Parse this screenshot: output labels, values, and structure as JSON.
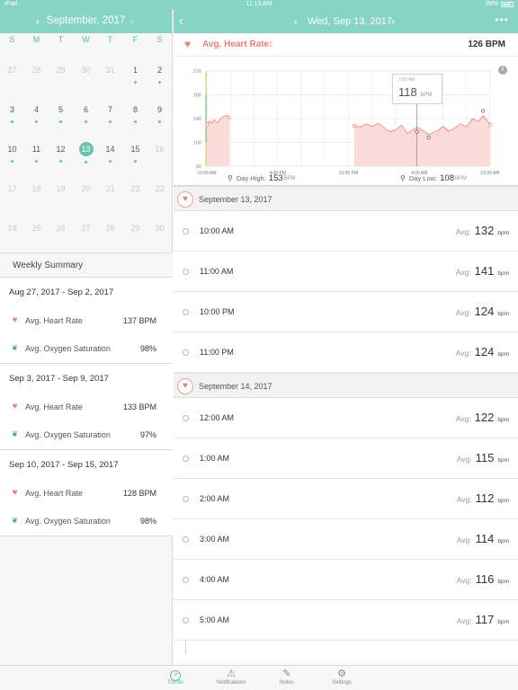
{
  "status_bar": {
    "left": "iPad",
    "time": "11:15 AM",
    "battery": "99%"
  },
  "calendar": {
    "month_title": "September, 2017",
    "prev_icon": "chevron-left-icon",
    "next_icon": "chevron-right-icon",
    "weekdays": [
      "S",
      "M",
      "T",
      "W",
      "T",
      "F",
      "S"
    ],
    "selected_day": "13",
    "weeks": [
      [
        {
          "d": "27",
          "dim": true
        },
        {
          "d": "28",
          "dim": true
        },
        {
          "d": "29",
          "dim": true
        },
        {
          "d": "30",
          "dim": true
        },
        {
          "d": "31",
          "dim": true
        },
        {
          "d": "1",
          "dot": true
        },
        {
          "d": "2",
          "dot": true
        }
      ],
      [
        {
          "d": "3",
          "dot": true
        },
        {
          "d": "4",
          "dot": true
        },
        {
          "d": "5",
          "dot": true
        },
        {
          "d": "6",
          "dot": true
        },
        {
          "d": "7",
          "dot": true
        },
        {
          "d": "8",
          "dot": true
        },
        {
          "d": "9",
          "dot": true
        }
      ],
      [
        {
          "d": "10",
          "dot": true
        },
        {
          "d": "11",
          "dot": true
        },
        {
          "d": "12",
          "dot": true
        },
        {
          "d": "13",
          "dot": true,
          "sel": true
        },
        {
          "d": "14",
          "dot": true
        },
        {
          "d": "15",
          "dot": true
        },
        {
          "d": "16",
          "dim": true
        }
      ],
      [
        {
          "d": "17",
          "dim": true
        },
        {
          "d": "18",
          "dim": true
        },
        {
          "d": "19",
          "dim": true
        },
        {
          "d": "20",
          "dim": true
        },
        {
          "d": "21",
          "dim": true
        },
        {
          "d": "22",
          "dim": true
        },
        {
          "d": "23",
          "dim": true
        }
      ],
      [
        {
          "d": "24",
          "dim": true
        },
        {
          "d": "25",
          "dim": true
        },
        {
          "d": "26",
          "dim": true
        },
        {
          "d": "27",
          "dim": true
        },
        {
          "d": "28",
          "dim": true
        },
        {
          "d": "29",
          "dim": true
        },
        {
          "d": "30",
          "dim": true
        }
      ]
    ]
  },
  "weekly_summary": {
    "title": "Weekly Summary",
    "weeks": [
      {
        "range": "Aug 27, 2017 - Sep 2, 2017",
        "hr_label": "Avg. Heart Rate",
        "hr_value": "137 BPM",
        "o2_label": "Avg. Oxygen Saturation",
        "o2_value": "98%"
      },
      {
        "range": "Sep 3, 2017 - Sep 9, 2017",
        "hr_label": "Avg. Heart Rate",
        "hr_value": "133 BPM",
        "o2_label": "Avg. Oxygen Saturation",
        "o2_value": "97%"
      },
      {
        "range": "Sep 10, 2017 - Sep 15, 2017",
        "hr_label": "Avg. Heart Rate",
        "hr_value": "128 BPM",
        "o2_label": "Avg. Oxygen Saturation",
        "o2_value": "98%"
      }
    ]
  },
  "detail": {
    "nav_title": "Wed, Sep 13, 2017",
    "more_icon": "more-icon",
    "heart_rate_label": "Avg. Heart Rate:",
    "heart_rate_value": "126 BPM",
    "tooltip_time": "3:50 AM",
    "tooltip_value": "118",
    "tooltip_unit": "BPM",
    "day_high_label": "Day High:",
    "day_high_value": "153",
    "day_low_label": "Day Low:",
    "day_low_value": "108",
    "bpm_unit": "BPM"
  },
  "chart_data": {
    "type": "area",
    "y_ticks": [
      60,
      100,
      140,
      180,
      220
    ],
    "ylim": [
      60,
      220
    ],
    "x_ticks": [
      "10:00 AM",
      "4:00 PM",
      "10:00 PM",
      "4:00 AM",
      "10:00 AM"
    ],
    "xlim_hours": [
      0,
      24
    ],
    "color": "#f08a80",
    "fill": "#fbdbd8",
    "segments": [
      [
        [
          0,
          130
        ],
        [
          0.2,
          136
        ],
        [
          0.4,
          132
        ],
        [
          0.6,
          138
        ],
        [
          0.9,
          133
        ],
        [
          1.2,
          141
        ],
        [
          1.5,
          144
        ],
        [
          1.7,
          146
        ],
        [
          1.9,
          142
        ]
      ],
      [
        [
          12.5,
          128
        ],
        [
          13,
          126
        ],
        [
          13.5,
          131
        ],
        [
          14,
          127
        ],
        [
          14.5,
          132
        ],
        [
          15,
          125
        ],
        [
          15.5,
          118
        ],
        [
          16,
          121
        ],
        [
          16.5,
          129
        ],
        [
          17,
          115
        ],
        [
          17.3,
          119
        ],
        [
          17.8,
          126
        ],
        [
          18.3,
          120
        ],
        [
          18.8,
          113
        ],
        [
          19.2,
          117
        ],
        [
          19.6,
          120
        ],
        [
          20,
          127
        ],
        [
          20.5,
          119
        ],
        [
          21,
          124
        ],
        [
          21.5,
          131
        ],
        [
          22,
          126
        ],
        [
          22.5,
          140
        ],
        [
          23,
          135
        ],
        [
          23.4,
          145
        ],
        [
          23.7,
          138
        ],
        [
          24,
          130
        ]
      ]
    ]
  },
  "readings": [
    {
      "date": "September 13, 2017",
      "entries": [
        {
          "time": "10:00 AM",
          "avg_label": "Avg:",
          "value": "132",
          "unit": "bpm"
        },
        {
          "time": "11:00 AM",
          "avg_label": "Avg:",
          "value": "141",
          "unit": "bpm"
        },
        {
          "time": "10:00 PM",
          "avg_label": "Avg:",
          "value": "124",
          "unit": "bpm"
        },
        {
          "time": "11:00 PM",
          "avg_label": "Avg:",
          "value": "124",
          "unit": "bpm"
        }
      ]
    },
    {
      "date": "September 14, 2017",
      "entries": [
        {
          "time": "12:00 AM",
          "avg_label": "Avg:",
          "value": "122",
          "unit": "bpm"
        },
        {
          "time": "1:00 AM",
          "avg_label": "Avg:",
          "value": "115",
          "unit": "bpm"
        },
        {
          "time": "2:00 AM",
          "avg_label": "Avg:",
          "value": "112",
          "unit": "bpm"
        },
        {
          "time": "3:00 AM",
          "avg_label": "Avg:",
          "value": "114",
          "unit": "bpm"
        },
        {
          "time": "4:00 AM",
          "avg_label": "Avg:",
          "value": "116",
          "unit": "bpm"
        },
        {
          "time": "5:00 AM",
          "avg_label": "Avg:",
          "value": "117",
          "unit": "bpm"
        }
      ]
    }
  ],
  "tabs": [
    {
      "label": "Trends",
      "icon": "trends-icon",
      "active": true
    },
    {
      "label": "Notifications",
      "icon": "warning-icon",
      "active": false
    },
    {
      "label": "Notes",
      "icon": "pencil-icon",
      "active": false
    },
    {
      "label": "Settings",
      "icon": "gear-icon",
      "active": false
    }
  ]
}
